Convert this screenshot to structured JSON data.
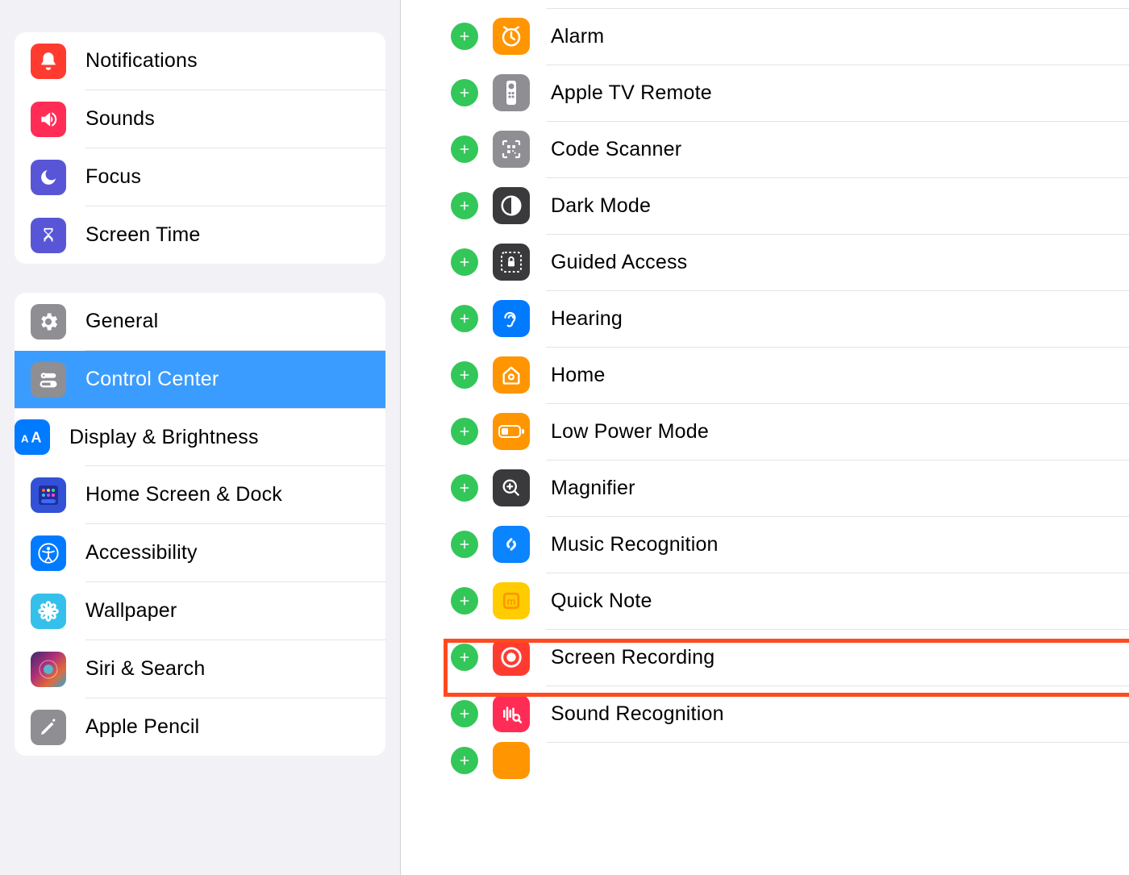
{
  "sidebar": {
    "group1": [
      {
        "key": "notifications",
        "label": "Notifications"
      },
      {
        "key": "sounds",
        "label": "Sounds"
      },
      {
        "key": "focus",
        "label": "Focus"
      },
      {
        "key": "screentime",
        "label": "Screen Time"
      }
    ],
    "group2": [
      {
        "key": "general",
        "label": "General"
      },
      {
        "key": "controlcenter",
        "label": "Control Center"
      },
      {
        "key": "display",
        "label": "Display & Brightness"
      },
      {
        "key": "homescreen",
        "label": "Home Screen & Dock"
      },
      {
        "key": "accessibility",
        "label": "Accessibility"
      },
      {
        "key": "wallpaper",
        "label": "Wallpaper"
      },
      {
        "key": "siri",
        "label": "Siri & Search"
      },
      {
        "key": "applepencil",
        "label": "Apple Pencil"
      }
    ],
    "selected_key": "controlcenter"
  },
  "detail": {
    "items": [
      {
        "key": "alarm",
        "label": "Alarm"
      },
      {
        "key": "appletv",
        "label": "Apple TV Remote"
      },
      {
        "key": "codescanner",
        "label": "Code Scanner"
      },
      {
        "key": "darkmode",
        "label": "Dark Mode"
      },
      {
        "key": "guided",
        "label": "Guided Access"
      },
      {
        "key": "hearing",
        "label": "Hearing"
      },
      {
        "key": "home",
        "label": "Home"
      },
      {
        "key": "lowpower",
        "label": "Low Power Mode"
      },
      {
        "key": "magnifier",
        "label": "Magnifier"
      },
      {
        "key": "music",
        "label": "Music Recognition"
      },
      {
        "key": "quicknote",
        "label": "Quick Note"
      },
      {
        "key": "screenrec",
        "label": "Screen Recording"
      },
      {
        "key": "soundrec",
        "label": "Sound Recognition"
      }
    ],
    "highlighted_key": "screenrec",
    "peek_key": "next"
  },
  "colors": {
    "add_green": "#33c759",
    "select_blue": "#3b9cff",
    "highlight_orange": "#ff4a1f"
  }
}
